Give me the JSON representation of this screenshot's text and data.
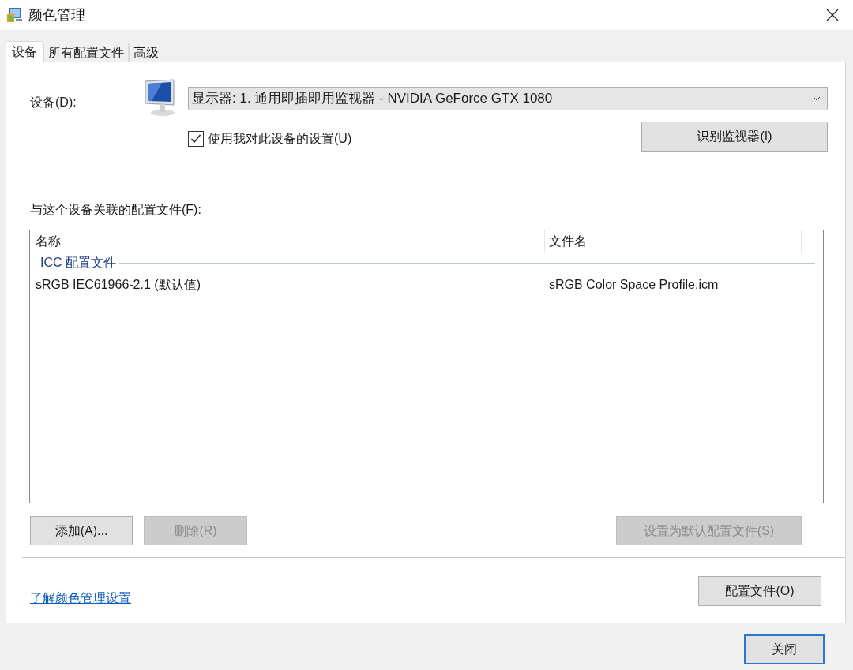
{
  "window": {
    "title": "颜色管理"
  },
  "tabs": [
    {
      "label": "设备",
      "selected": true
    },
    {
      "label": "所有配置文件",
      "selected": false
    },
    {
      "label": "高级",
      "selected": false
    }
  ],
  "device": {
    "label": "设备(D):",
    "value": "显示器: 1. 通用即插即用监视器 - NVIDIA GeForce GTX 1080",
    "use_my_settings": {
      "label": "使用我对此设备的设置(U)",
      "checked": true
    },
    "identify_button": "识别监视器(I)"
  },
  "profiles": {
    "label": "与这个设备关联的配置文件(F):",
    "columns": [
      "名称",
      "文件名"
    ],
    "groups": [
      {
        "name": "ICC 配置文件",
        "rows": [
          {
            "name": "sRGB IEC61966-2.1 (默认值)",
            "file": "sRGB Color Space Profile.icm"
          }
        ]
      }
    ]
  },
  "list_buttons": [
    {
      "label": "添加(A)...",
      "disabled": false
    },
    {
      "label": "删除(R)",
      "disabled": true
    },
    {
      "label": "设置为默认配置文件(S)",
      "disabled": true
    }
  ],
  "link": "了解颜色管理设置",
  "profiles_button": "配置文件(O)",
  "close_button": "关闭"
}
